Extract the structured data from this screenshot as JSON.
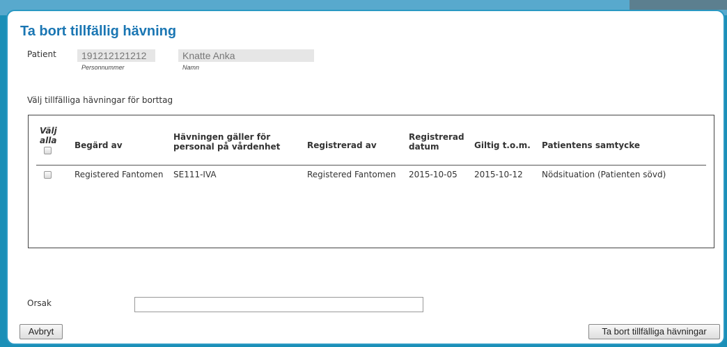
{
  "dialog": {
    "title": "Ta bort tillfällig hävning"
  },
  "patient": {
    "label": "Patient",
    "personnummer": "191212121212",
    "personnummer_caption": "Personnummer",
    "namn": "Knatte Anka",
    "namn_caption": "Namn"
  },
  "instruction": "Välj tillfälliga hävningar för borttag",
  "table": {
    "headers": {
      "select_all_line1": "Välj",
      "select_all_line2": "alla",
      "requested_by": "Begärd av",
      "applies_line1": "Hävningen gäller för",
      "applies_line2": "personal på vårdenhet",
      "registered_by": "Registrerad av",
      "registered_date_line1": "Registrerad",
      "registered_date_line2": "datum",
      "valid_until": "Giltig t.o.m.",
      "consent": "Patientens samtycke"
    },
    "rows": [
      {
        "checked": false,
        "requested_by": "Registered Fantomen",
        "care_unit": "SE111-IVA",
        "registered_by": "Registered Fantomen",
        "registered_date": "2015-10-05",
        "valid_until": "2015-10-12",
        "consent": "Nödsituation (Patienten sövd)"
      }
    ]
  },
  "reason": {
    "label": "Orsak",
    "value": ""
  },
  "buttons": {
    "cancel": "Avbryt",
    "remove": "Ta bort tillfälliga hävningar"
  }
}
